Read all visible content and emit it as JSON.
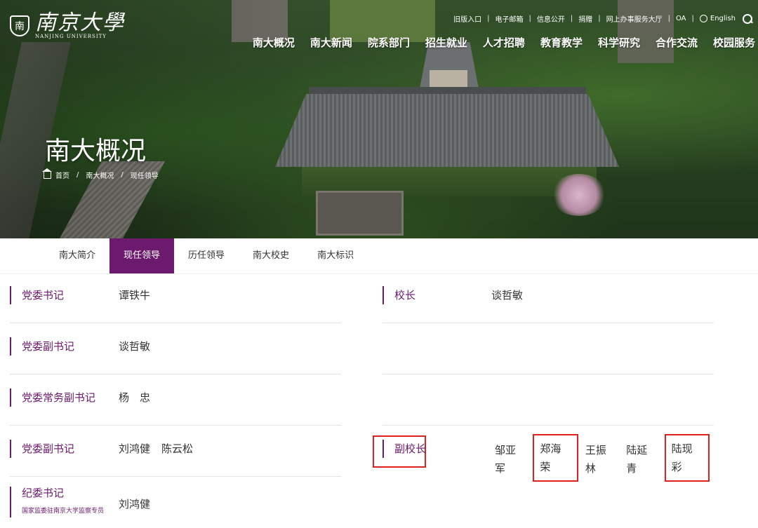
{
  "logo": {
    "seal": "南",
    "name_cn": "南京大學",
    "name_en": "NANJING UNIVERSITY"
  },
  "toplinks": [
    "旧版入口",
    "电子邮箱",
    "信息公开",
    "捐赠",
    "网上办事服务大厅",
    "OA",
    "English"
  ],
  "mainnav": [
    "南大概况",
    "南大新闻",
    "院系部门",
    "招生就业",
    "人才招聘",
    "教育教学",
    "科学研究",
    "合作交流",
    "校园服务"
  ],
  "hero": {
    "title": "南大概况"
  },
  "breadcrumb": [
    "首页",
    "南大概况",
    "现任领导"
  ],
  "tabs": [
    "南大简介",
    "现任领导",
    "历任领导",
    "南大校史",
    "南大标识"
  ],
  "active_tab": 1,
  "left_rows": [
    {
      "role": "党委书记",
      "names": [
        "谭铁牛"
      ]
    },
    {
      "role": "党委副书记",
      "names": [
        "谈哲敏"
      ]
    },
    {
      "role": "党委常务副书记",
      "names": [
        "杨　忠"
      ]
    },
    {
      "role": "党委副书记",
      "names": [
        "刘鸿健",
        "陈云松"
      ]
    },
    {
      "role": "纪委书记",
      "names": [
        "刘鸿健"
      ],
      "sub": "国家监委驻南京大学监察专员"
    }
  ],
  "right_rows": [
    {
      "role": "校长",
      "names": [
        "谈哲敏"
      ]
    },
    {
      "role": "副校长",
      "names": [
        "邹亚军",
        "郑海荣",
        "王振林",
        "陆延青",
        "陆现彩"
      ],
      "highlighted": [
        1,
        4
      ]
    }
  ],
  "colors": {
    "accent": "#6b1a6e",
    "highlight": "#e01f1f"
  }
}
